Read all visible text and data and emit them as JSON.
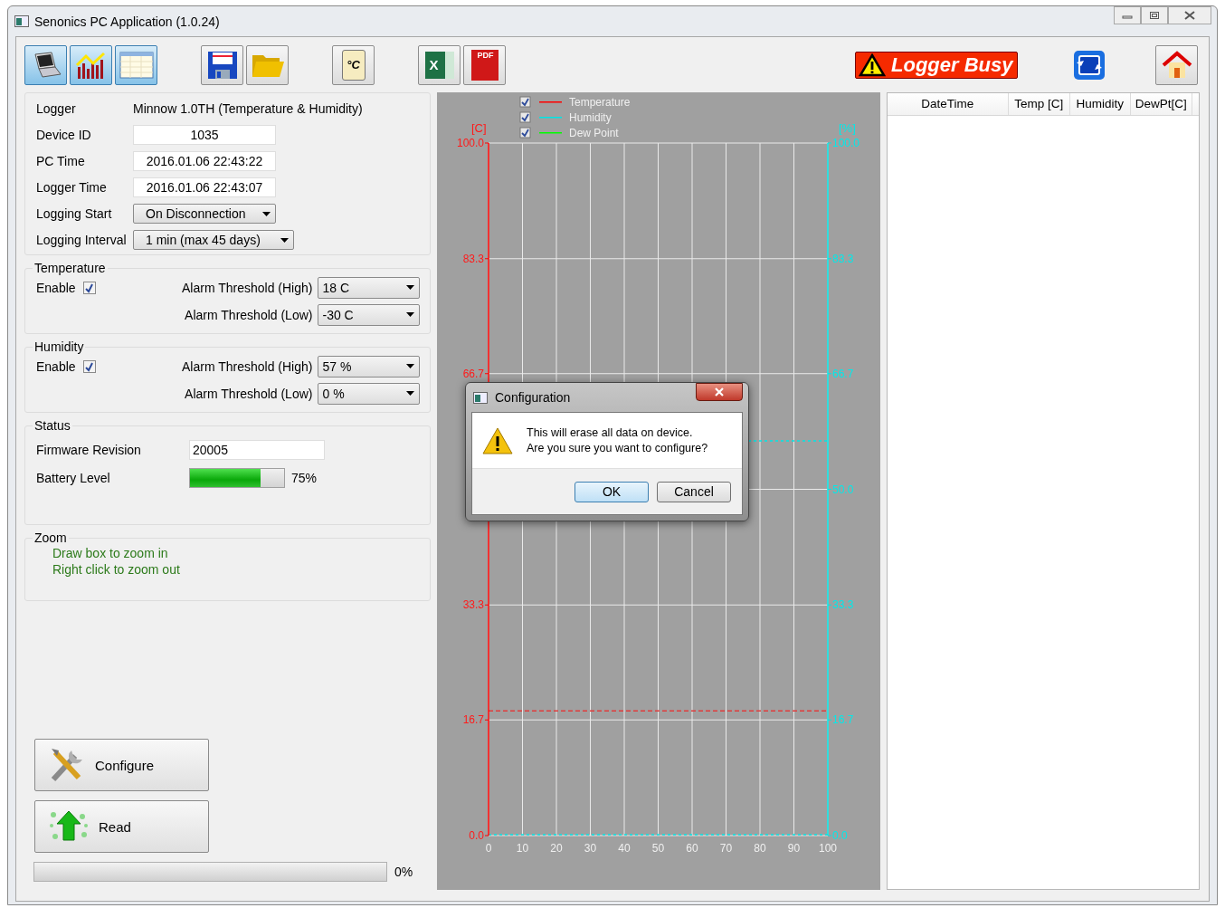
{
  "window": {
    "title": "Senonics PC Application (1.0.24)"
  },
  "toolbar": [
    {
      "kind": "laptop",
      "selected": true
    },
    {
      "kind": "chart",
      "selected": true
    },
    {
      "kind": "table",
      "selected": true
    },
    {
      "kind": "save",
      "selected": false
    },
    {
      "kind": "folder",
      "selected": false
    },
    {
      "kind": "unit",
      "selected": false,
      "label": "°C"
    },
    {
      "kind": "excel",
      "selected": false,
      "label": "X"
    },
    {
      "kind": "pdf",
      "selected": false,
      "label": "PDF"
    }
  ],
  "status_badge": "Logger Busy",
  "device": [
    {
      "label": "Logger",
      "kind": "text",
      "value": "Minnow 1.0TH (Temperature & Humidity)"
    },
    {
      "label": "Device ID",
      "kind": "input",
      "value": "1035"
    },
    {
      "label": "PC Time",
      "kind": "input",
      "value": "2016.01.06 22:43:22"
    },
    {
      "label": "Logger Time",
      "kind": "input",
      "value": "2016.01.06 22:43:07"
    },
    {
      "label": "Logging Start",
      "kind": "select",
      "value": "On Disconnection"
    },
    {
      "label": "Logging Interval",
      "kind": "select",
      "value": "1 min (max 45 days)"
    }
  ],
  "sensors": [
    {
      "title": "Temperature",
      "enable_label": "Enable",
      "enabled": true,
      "alarms": [
        {
          "label": "Alarm Threshold (High)",
          "value": "18 C"
        },
        {
          "label": "Alarm Threshold (Low)",
          "value": "-30 C"
        }
      ]
    },
    {
      "title": "Humidity",
      "enable_label": "Enable",
      "enabled": true,
      "alarms": [
        {
          "label": "Alarm Threshold (High)",
          "value": "57 %"
        },
        {
          "label": "Alarm Threshold (Low)",
          "value": "0 %"
        }
      ]
    }
  ],
  "status": {
    "title": "Status",
    "firmware_label": "Firmware Revision",
    "firmware": "20005",
    "battery_label": "Battery Level",
    "battery": {
      "level": 0.75
    },
    "battery_reading": "75%"
  },
  "zoom": {
    "title": "Zoom",
    "hints": [
      "Draw box to zoom in",
      "Right click to zoom out"
    ]
  },
  "actions": [
    {
      "kind": "configure",
      "label": "Configure"
    },
    {
      "kind": "read",
      "label": "Read"
    }
  ],
  "progress": {
    "level": 0,
    "reading": "0%"
  },
  "chart": {
    "legend": [
      {
        "label": "Temperature",
        "checked": true,
        "color": "#ff0000"
      },
      {
        "label": "Humidity",
        "checked": true,
        "color": "#00e5e5"
      },
      {
        "label": "Dew Point",
        "checked": true,
        "color": "#00ff00"
      }
    ],
    "chart_data": {
      "type": "line",
      "ylabel": "[C]",
      "y2label": "[%]",
      "xlim": [
        0,
        100
      ],
      "ylim": [
        0,
        100
      ],
      "xticks": [
        0,
        10,
        20,
        30,
        40,
        50,
        60,
        70,
        80,
        90,
        100
      ],
      "yticks": [
        {
          "value": 0,
          "label": "0.0"
        },
        {
          "value": 16.7,
          "label": "16.7"
        },
        {
          "value": 33.3,
          "label": "33.3"
        },
        {
          "value": 66.7,
          "label": "66.7"
        },
        {
          "value": 83.3,
          "label": "83.3"
        },
        {
          "value": 100,
          "label": "100.0"
        }
      ],
      "y2ticks": [
        {
          "value": 0,
          "label": "0.0"
        },
        {
          "value": 16.7,
          "label": "16.7"
        },
        {
          "value": 33.3,
          "label": "33.3"
        },
        {
          "value": 50,
          "label": "50.0"
        },
        {
          "value": 66.7,
          "label": "66.7"
        },
        {
          "value": 83.3,
          "label": "83.3"
        },
        {
          "value": 100,
          "label": "100.0"
        }
      ],
      "y2lim": [
        0,
        100
      ],
      "grid": true,
      "ref_lines": [
        {
          "axis": "y",
          "value": 18,
          "color": "#e03c3c"
        },
        {
          "axis": "y2",
          "value": 57,
          "color": "#00e5e5"
        },
        {
          "axis": "y2",
          "value": 0,
          "color": "#00e5e5"
        }
      ]
    }
  },
  "table": {
    "columns": [
      "DateTime",
      "Temp [C]",
      "Humidity",
      "DewPt[C]"
    ]
  },
  "dialog": {
    "title": "Configuration",
    "lines": [
      "This will erase all data on device.",
      "Are you sure you want to configure?"
    ],
    "buttons": [
      {
        "label": "OK",
        "default": true
      },
      {
        "label": "Cancel",
        "default": false
      }
    ]
  }
}
